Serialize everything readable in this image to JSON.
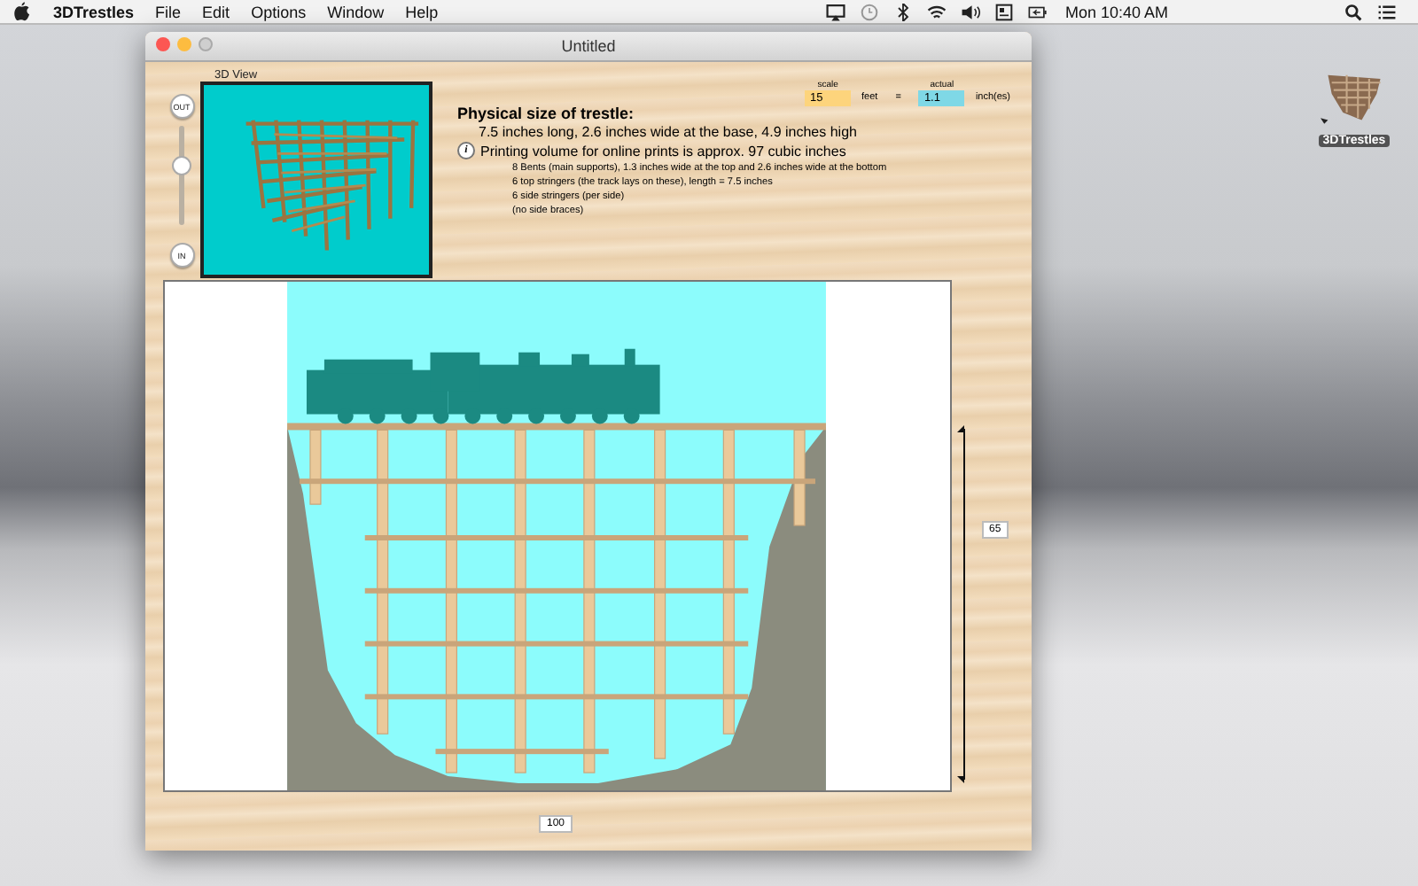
{
  "menu_bar": {
    "app_name": "3DTrestles",
    "items": [
      "File",
      "Edit",
      "Options",
      "Window",
      "Help"
    ],
    "clock": "Mon 10:40 AM"
  },
  "window": {
    "title": "Untitled"
  },
  "zoom": {
    "out_label": "OUT",
    "in_label": "IN",
    "level": 0.6
  },
  "view_3d": {
    "label": "3D View"
  },
  "size_panel": {
    "heading": "Physical size of trestle:",
    "scale_label": "scale",
    "scale_value": "15",
    "scale_unit": "feet",
    "equals": "=",
    "actual_label": "actual",
    "actual_value": "1.1",
    "actual_unit": "inch(es)",
    "summary": "7.5 inches long, 2.6 inches wide at the base, 4.9 inches high",
    "info_icon": "i",
    "volume": "Printing volume for online prints is approx. 97 cubic inches",
    "details": [
      "8 Bents (main supports), 1.3 inches wide at the top and 2.6 inches wide at the bottom",
      "6 top stringers (the track lays on these), length = 7.5 inches",
      "6 side stringers (per side)",
      "(no side braces)"
    ]
  },
  "canvas": {
    "height_value": "65",
    "width_value": "100"
  },
  "desktop_icon": {
    "label": "3DTrestles"
  }
}
